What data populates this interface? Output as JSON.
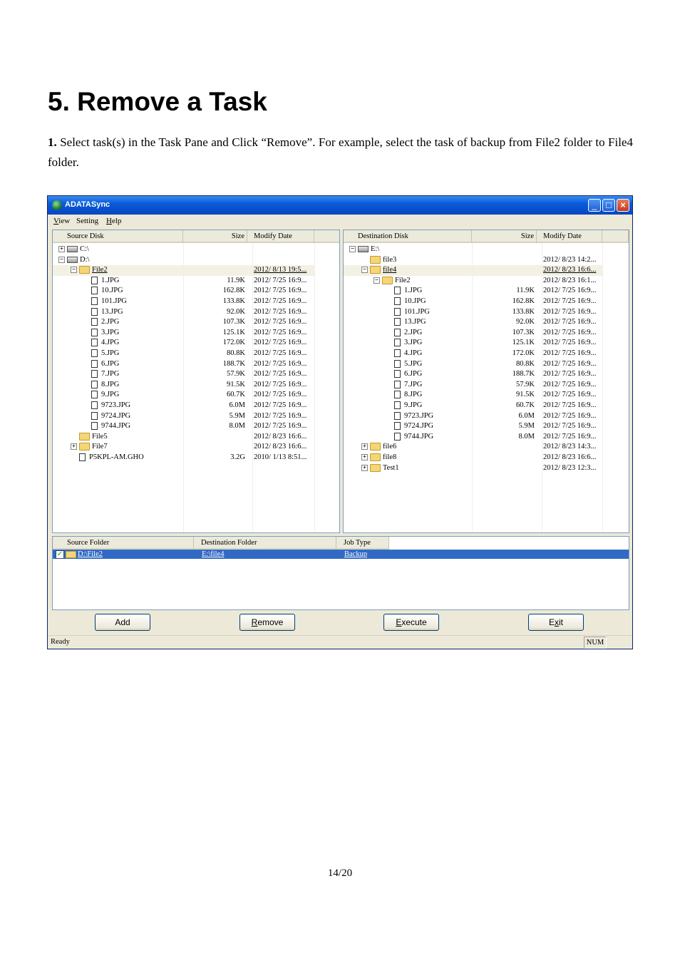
{
  "heading": "5. Remove a Task",
  "instruction": {
    "step": "1.",
    "text": "Select task(s) in the Task Pane and Click “Remove”. For example, select the task of backup from File2 folder to File4 folder."
  },
  "page_number": "14/20",
  "window": {
    "title": "ADATASync",
    "controls": {
      "minimize": "_",
      "maximize": "□",
      "close": "×"
    },
    "menu": [
      {
        "key": "V",
        "rest": "iew"
      },
      {
        "key": "",
        "rest": "Setting"
      },
      {
        "key": "H",
        "rest": "elp"
      }
    ],
    "source": {
      "headers": {
        "name": "Source Disk",
        "size": "Size",
        "date": "Modify Date"
      },
      "rows": [
        {
          "indent": 0,
          "exp": "+",
          "icon": "drive",
          "name": "C:\\",
          "size": "",
          "date": ""
        },
        {
          "indent": 0,
          "exp": "−",
          "icon": "drive",
          "name": "D:\\",
          "size": "",
          "date": ""
        },
        {
          "indent": 1,
          "exp": "−",
          "icon": "folder",
          "name": "File2",
          "size": "",
          "date": "2012/ 8/13 19:5...",
          "sel": true
        },
        {
          "indent": 2,
          "exp": "",
          "icon": "file",
          "name": "1.JPG",
          "size": "11.9K",
          "date": "2012/ 7/25 16:9..."
        },
        {
          "indent": 2,
          "exp": "",
          "icon": "file",
          "name": "10.JPG",
          "size": "162.8K",
          "date": "2012/ 7/25 16:9..."
        },
        {
          "indent": 2,
          "exp": "",
          "icon": "file",
          "name": "101.JPG",
          "size": "133.8K",
          "date": "2012/ 7/25 16:9..."
        },
        {
          "indent": 2,
          "exp": "",
          "icon": "file",
          "name": "13.JPG",
          "size": "92.0K",
          "date": "2012/ 7/25 16:9..."
        },
        {
          "indent": 2,
          "exp": "",
          "icon": "file",
          "name": "2.JPG",
          "size": "107.3K",
          "date": "2012/ 7/25 16:9..."
        },
        {
          "indent": 2,
          "exp": "",
          "icon": "file",
          "name": "3.JPG",
          "size": "125.1K",
          "date": "2012/ 7/25 16:9..."
        },
        {
          "indent": 2,
          "exp": "",
          "icon": "file",
          "name": "4.JPG",
          "size": "172.0K",
          "date": "2012/ 7/25 16:9..."
        },
        {
          "indent": 2,
          "exp": "",
          "icon": "file",
          "name": "5.JPG",
          "size": "80.8K",
          "date": "2012/ 7/25 16:9..."
        },
        {
          "indent": 2,
          "exp": "",
          "icon": "file",
          "name": "6.JPG",
          "size": "188.7K",
          "date": "2012/ 7/25 16:9..."
        },
        {
          "indent": 2,
          "exp": "",
          "icon": "file",
          "name": "7.JPG",
          "size": "57.9K",
          "date": "2012/ 7/25 16:9..."
        },
        {
          "indent": 2,
          "exp": "",
          "icon": "file",
          "name": "8.JPG",
          "size": "91.5K",
          "date": "2012/ 7/25 16:9..."
        },
        {
          "indent": 2,
          "exp": "",
          "icon": "file",
          "name": "9.JPG",
          "size": "60.7K",
          "date": "2012/ 7/25 16:9..."
        },
        {
          "indent": 2,
          "exp": "",
          "icon": "file",
          "name": "9723.JPG",
          "size": "6.0M",
          "date": "2012/ 7/25 16:9..."
        },
        {
          "indent": 2,
          "exp": "",
          "icon": "file",
          "name": "9724.JPG",
          "size": "5.9M",
          "date": "2012/ 7/25 16:9..."
        },
        {
          "indent": 2,
          "exp": "",
          "icon": "file",
          "name": "9744.JPG",
          "size": "8.0M",
          "date": "2012/ 7/25 16:9..."
        },
        {
          "indent": 1,
          "exp": "",
          "icon": "folder",
          "name": "File5",
          "size": "",
          "date": "2012/ 8/23 16:6..."
        },
        {
          "indent": 1,
          "exp": "+",
          "icon": "folder",
          "name": "File7",
          "size": "",
          "date": "2012/ 8/23 16:6..."
        },
        {
          "indent": 1,
          "exp": "",
          "icon": "file",
          "name": "P5KPL-AM.GHO",
          "size": "3.2G",
          "date": "2010/ 1/13 8:51..."
        }
      ]
    },
    "destination": {
      "headers": {
        "name": "Destination Disk",
        "size": "Size",
        "date": "Modify Date"
      },
      "rows": [
        {
          "indent": 0,
          "exp": "−",
          "icon": "drive",
          "name": "E:\\",
          "size": "",
          "date": ""
        },
        {
          "indent": 1,
          "exp": "",
          "icon": "folder",
          "name": "file3",
          "size": "",
          "date": "2012/ 8/23 14:2..."
        },
        {
          "indent": 1,
          "exp": "−",
          "icon": "folder",
          "name": "file4",
          "size": "",
          "date": "2012/ 8/23 16:6...",
          "sel": true
        },
        {
          "indent": 2,
          "exp": "−",
          "icon": "folder",
          "name": "File2",
          "size": "",
          "date": "2012/ 8/23 16:1..."
        },
        {
          "indent": 3,
          "exp": "",
          "icon": "file",
          "name": "1.JPG",
          "size": "11.9K",
          "date": "2012/ 7/25 16:9..."
        },
        {
          "indent": 3,
          "exp": "",
          "icon": "file",
          "name": "10.JPG",
          "size": "162.8K",
          "date": "2012/ 7/25 16:9..."
        },
        {
          "indent": 3,
          "exp": "",
          "icon": "file",
          "name": "101.JPG",
          "size": "133.8K",
          "date": "2012/ 7/25 16:9..."
        },
        {
          "indent": 3,
          "exp": "",
          "icon": "file",
          "name": "13.JPG",
          "size": "92.0K",
          "date": "2012/ 7/25 16:9..."
        },
        {
          "indent": 3,
          "exp": "",
          "icon": "file",
          "name": "2.JPG",
          "size": "107.3K",
          "date": "2012/ 7/25 16:9..."
        },
        {
          "indent": 3,
          "exp": "",
          "icon": "file",
          "name": "3.JPG",
          "size": "125.1K",
          "date": "2012/ 7/25 16:9..."
        },
        {
          "indent": 3,
          "exp": "",
          "icon": "file",
          "name": "4.JPG",
          "size": "172.0K",
          "date": "2012/ 7/25 16:9..."
        },
        {
          "indent": 3,
          "exp": "",
          "icon": "file",
          "name": "5.JPG",
          "size": "80.8K",
          "date": "2012/ 7/25 16:9..."
        },
        {
          "indent": 3,
          "exp": "",
          "icon": "file",
          "name": "6.JPG",
          "size": "188.7K",
          "date": "2012/ 7/25 16:9..."
        },
        {
          "indent": 3,
          "exp": "",
          "icon": "file",
          "name": "7.JPG",
          "size": "57.9K",
          "date": "2012/ 7/25 16:9..."
        },
        {
          "indent": 3,
          "exp": "",
          "icon": "file",
          "name": "8.JPG",
          "size": "91.5K",
          "date": "2012/ 7/25 16:9..."
        },
        {
          "indent": 3,
          "exp": "",
          "icon": "file",
          "name": "9.JPG",
          "size": "60.7K",
          "date": "2012/ 7/25 16:9..."
        },
        {
          "indent": 3,
          "exp": "",
          "icon": "file",
          "name": "9723.JPG",
          "size": "6.0M",
          "date": "2012/ 7/25 16:9..."
        },
        {
          "indent": 3,
          "exp": "",
          "icon": "file",
          "name": "9724.JPG",
          "size": "5.9M",
          "date": "2012/ 7/25 16:9..."
        },
        {
          "indent": 3,
          "exp": "",
          "icon": "file",
          "name": "9744.JPG",
          "size": "8.0M",
          "date": "2012/ 7/25 16:9..."
        },
        {
          "indent": 1,
          "exp": "+",
          "icon": "folder",
          "name": "file6",
          "size": "",
          "date": "2012/ 8/23 14:3..."
        },
        {
          "indent": 1,
          "exp": "+",
          "icon": "folder",
          "name": "file8",
          "size": "",
          "date": "2012/ 8/23 16:6..."
        },
        {
          "indent": 1,
          "exp": "+",
          "icon": "folder",
          "name": "Test1",
          "size": "",
          "date": "2012/ 8/23 12:3..."
        }
      ]
    },
    "tasks": {
      "headers": {
        "source": "Source Folder",
        "destination": "Destination Folder",
        "type": "Job Type"
      },
      "rows": [
        {
          "checked": "✓",
          "source": "D:\\File2",
          "destination": "E:\\file4",
          "type": "Backup"
        }
      ]
    },
    "buttons": {
      "add": {
        "key": "",
        "rest": "Add"
      },
      "remove": {
        "key": "R",
        "rest": "emove"
      },
      "execute": {
        "key": "E",
        "rest": "xecute"
      },
      "exit": {
        "pre": "E",
        "key": "x",
        "rest": "it"
      }
    },
    "status": {
      "text": "Ready",
      "num": "NUM"
    },
    "colors": {
      "title_bar": "#0a5bd9",
      "selection": "#316ac5",
      "panel": "#ece9d8"
    }
  }
}
